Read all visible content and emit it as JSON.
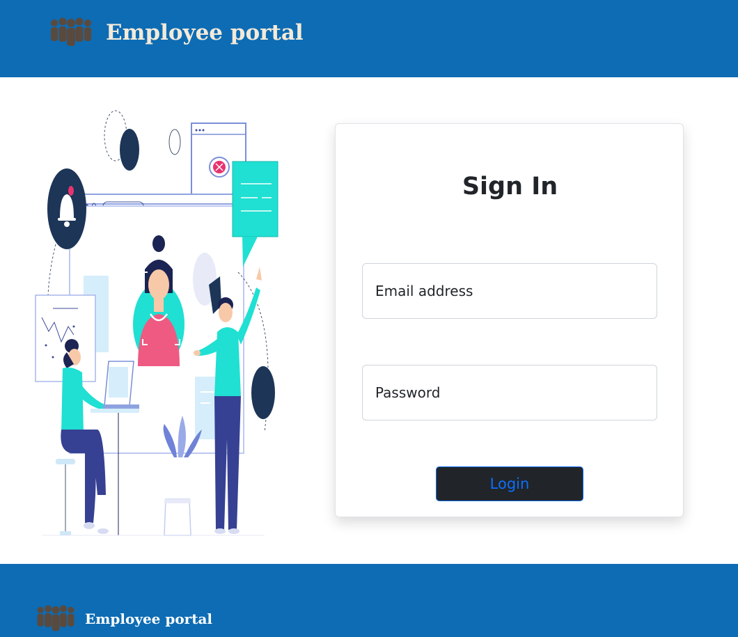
{
  "header": {
    "logo_icon": "people-group-icon",
    "title": "Employee portal"
  },
  "illustration": {
    "icon": "team-collaboration-illustration"
  },
  "login_card": {
    "title": "Sign In",
    "email": {
      "placeholder": "Email address",
      "value": ""
    },
    "password": {
      "placeholder": "Password",
      "value": ""
    },
    "login_label": "Login"
  },
  "footer": {
    "logo_icon": "people-group-icon",
    "title": "Employee portal"
  },
  "colors": {
    "brand_blue": "#0d6cb4",
    "button_dark": "#212529",
    "button_text": "#0d6efd",
    "accent_teal": "#1fe0d2",
    "navy": "#1d3557"
  }
}
